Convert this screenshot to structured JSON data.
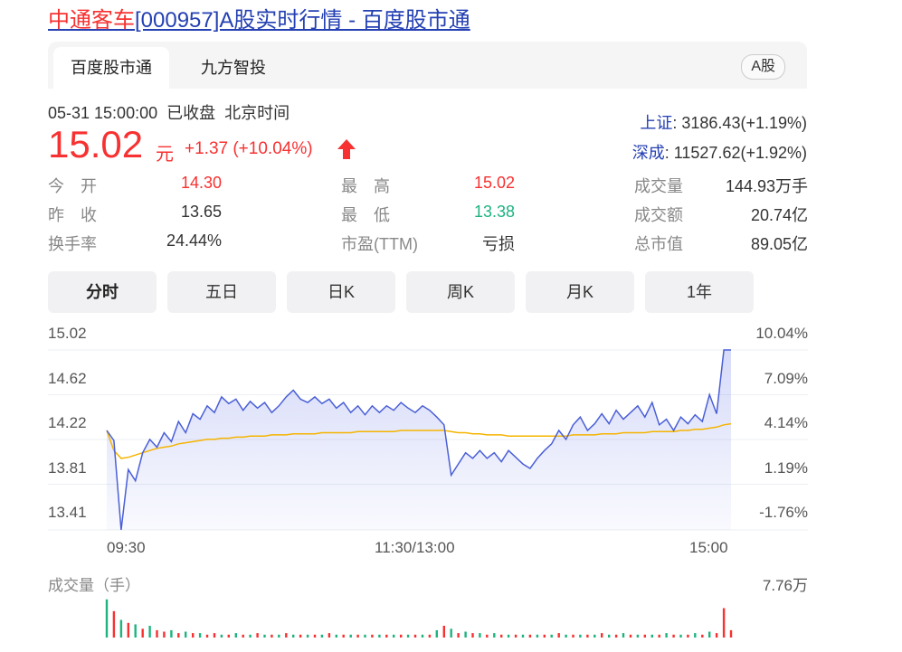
{
  "title": {
    "highlight": "中通客车",
    "rest": "[000957]A股实时行情 - 百度股市通"
  },
  "source_tabs": [
    {
      "label": "百度股市通"
    },
    {
      "label": "九方智投"
    }
  ],
  "market_tag": "A股",
  "status": {
    "datetime": "05-31 15:00:00",
    "state": "已收盘",
    "zone": "北京时间"
  },
  "quote": {
    "price": "15.02",
    "unit": "元",
    "change": "+1.37 (+10.04%)",
    "direction": "up"
  },
  "indices": [
    {
      "name": "上证",
      "value": ": 3186.43(+1.19%)"
    },
    {
      "name": "深成",
      "value": ": 11527.62(+1.92%)"
    }
  ],
  "stats": [
    {
      "label": "今　开",
      "value": "14.30",
      "color": "red"
    },
    {
      "label": "最　高",
      "value": "15.02",
      "color": "red"
    },
    {
      "label": "成交量",
      "value": "144.93万手",
      "color": "plain"
    },
    {
      "label": "昨　收",
      "value": "13.65",
      "color": "plain"
    },
    {
      "label": "最　低",
      "value": "13.38",
      "color": "green"
    },
    {
      "label": "成交额",
      "value": "20.74亿",
      "color": "plain"
    },
    {
      "label": "换手率",
      "value": "24.44%",
      "color": "plain"
    },
    {
      "label": "市盈(TTM)",
      "value": "亏损",
      "color": "plain"
    },
    {
      "label": "总市值",
      "value": "89.05亿",
      "color": "plain"
    }
  ],
  "period_tabs": [
    {
      "label": "分时",
      "active": true
    },
    {
      "label": "五日",
      "active": false
    },
    {
      "label": "日K",
      "active": false
    },
    {
      "label": "周K",
      "active": false
    },
    {
      "label": "月K",
      "active": false
    },
    {
      "label": "1年",
      "active": false
    }
  ],
  "colors": {
    "up": "#f73131",
    "down": "#1eb37f",
    "link": "#2440b3",
    "price_line": "#4a5fd6",
    "avg_line": "#f5b400"
  },
  "volume": {
    "label": "成交量（手）",
    "max_label": "7.76万"
  },
  "chart_data": {
    "type": "line",
    "title": "",
    "y_ticks_left": [
      "15.02",
      "14.62",
      "14.22",
      "13.81",
      "13.41"
    ],
    "y_ticks_right": [
      "10.04%",
      "7.09%",
      "4.14%",
      "1.19%",
      "-1.76%"
    ],
    "x_ticks": [
      "09:30",
      "11:30/13:00",
      "15:00"
    ],
    "ylim": [
      13.41,
      15.02
    ],
    "prev_close": 13.65,
    "series": [
      {
        "role": "price",
        "values": [
          14.3,
          14.21,
          13.41,
          13.95,
          13.85,
          14.1,
          14.22,
          14.15,
          14.28,
          14.2,
          14.38,
          14.28,
          14.45,
          14.4,
          14.52,
          14.46,
          14.6,
          14.54,
          14.58,
          14.48,
          14.56,
          14.5,
          14.55,
          14.46,
          14.52,
          14.6,
          14.66,
          14.58,
          14.55,
          14.6,
          14.54,
          14.58,
          14.5,
          14.55,
          14.46,
          14.52,
          14.44,
          14.52,
          14.46,
          14.52,
          14.48,
          14.55,
          14.5,
          14.46,
          14.52,
          14.48,
          14.42,
          14.35,
          13.9,
          14.0,
          14.1,
          14.05,
          14.12,
          14.05,
          14.1,
          14.02,
          14.12,
          14.06,
          14.0,
          13.96,
          14.05,
          14.12,
          14.18,
          14.3,
          14.22,
          14.35,
          14.42,
          14.3,
          14.36,
          14.45,
          14.36,
          14.48,
          14.4,
          14.46,
          14.52,
          14.42,
          14.55,
          14.35,
          14.4,
          14.3,
          14.42,
          14.36,
          14.44,
          14.38,
          14.62,
          14.45,
          15.02,
          15.02
        ]
      },
      {
        "role": "average",
        "values": [
          14.3,
          14.12,
          14.05,
          14.06,
          14.08,
          14.1,
          14.12,
          14.14,
          14.15,
          14.16,
          14.18,
          14.19,
          14.2,
          14.21,
          14.22,
          14.22,
          14.23,
          14.23,
          14.24,
          14.24,
          14.25,
          14.25,
          14.25,
          14.26,
          14.26,
          14.26,
          14.27,
          14.27,
          14.27,
          14.27,
          14.28,
          14.28,
          14.28,
          14.28,
          14.28,
          14.29,
          14.29,
          14.29,
          14.29,
          14.29,
          14.29,
          14.3,
          14.3,
          14.3,
          14.3,
          14.3,
          14.3,
          14.3,
          14.29,
          14.28,
          14.28,
          14.27,
          14.27,
          14.26,
          14.26,
          14.26,
          14.25,
          14.25,
          14.25,
          14.25,
          14.25,
          14.25,
          14.25,
          14.25,
          14.25,
          14.26,
          14.26,
          14.26,
          14.26,
          14.27,
          14.27,
          14.27,
          14.28,
          14.28,
          14.28,
          14.28,
          14.29,
          14.29,
          14.29,
          14.29,
          14.3,
          14.3,
          14.31,
          14.31,
          14.32,
          14.33,
          14.35,
          14.36
        ]
      }
    ],
    "volume_values": [
      2.6,
      1.8,
      1.2,
      1.0,
      0.9,
      0.6,
      0.8,
      0.5,
      0.4,
      0.5,
      0.3,
      0.4,
      0.3,
      0.3,
      0.2,
      0.3,
      0.2,
      0.2,
      0.3,
      0.2,
      0.2,
      0.3,
      0.2,
      0.2,
      0.2,
      0.3,
      0.2,
      0.2,
      0.2,
      0.2,
      0.2,
      0.3,
      0.2,
      0.2,
      0.2,
      0.2,
      0.2,
      0.2,
      0.2,
      0.2,
      0.2,
      0.2,
      0.2,
      0.2,
      0.2,
      0.2,
      0.5,
      0.8,
      0.6,
      0.3,
      0.4,
      0.3,
      0.3,
      0.2,
      0.3,
      0.2,
      0.2,
      0.2,
      0.2,
      0.2,
      0.2,
      0.2,
      0.2,
      0.3,
      0.2,
      0.2,
      0.2,
      0.2,
      0.2,
      0.3,
      0.2,
      0.2,
      0.3,
      0.2,
      0.2,
      0.2,
      0.2,
      0.2,
      0.3,
      0.2,
      0.2,
      0.2,
      0.3,
      0.2,
      0.4,
      0.3,
      2.0,
      0.5
    ],
    "volume_colors": [
      "down",
      "up",
      "down",
      "up",
      "down",
      "up",
      "down",
      "up",
      "up",
      "down",
      "up",
      "down",
      "up",
      "down",
      "up",
      "up",
      "down",
      "up",
      "down",
      "up",
      "down",
      "up",
      "down",
      "up",
      "down",
      "up",
      "down",
      "up",
      "down",
      "up",
      "down",
      "up",
      "down",
      "up",
      "down",
      "up",
      "down",
      "up",
      "down",
      "up",
      "down",
      "up",
      "down",
      "up",
      "down",
      "up",
      "down",
      "up",
      "down",
      "up",
      "down",
      "up",
      "down",
      "up",
      "down",
      "up",
      "down",
      "up",
      "down",
      "up",
      "down",
      "up",
      "down",
      "up",
      "down",
      "up",
      "down",
      "up",
      "down",
      "up",
      "down",
      "up",
      "down",
      "up",
      "down",
      "up",
      "down",
      "up",
      "down",
      "up",
      "down",
      "up",
      "down",
      "up",
      "down",
      "up",
      "up",
      "up"
    ]
  }
}
